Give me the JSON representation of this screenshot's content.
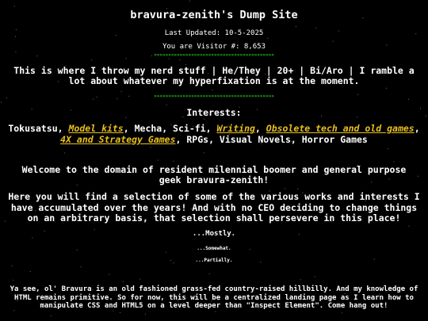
{
  "page": {
    "title": "bravura-zenith's Dump Site",
    "last_updated": "Last Updated: 10-5-2025",
    "visitor_counter": "You are Visitor #: 8,653",
    "divider_pattern": "»»»»»»»»»»»»»»»»»»»»»»»»»»»»»»»»»»»»»»»»»»",
    "tagline": "This is where I throw my nerd stuff | He/They | 20+ | Bi/Aro | I ramble a lot about whatever my hyperfixation is at the moment.",
    "interests_heading": "Interests:",
    "interests": {
      "p1": "Tokusatsu, ",
      "link_model_kits": "Model kits",
      "p2": ", Mecha, Sci-fi, ",
      "link_writing": "Writing",
      "p3": ", ",
      "link_obsolete_tech": "Obsolete tech and old games",
      "p4": ", ",
      "link_4x": "4X and Strategy Games",
      "p5": ", RPGs, Visual Novels, Horror Games"
    },
    "welcome": "Welcome to the domain of resident milennial boomer and general purpose geek bravura-zenith!",
    "intro": "Here you will find a selection of some of the various works and interests I have accumulated over the years! And with no CEO deciding to change things on an arbitrary basis, that selection shall persevere in this place!",
    "mostly": "...Mostly.",
    "somewhat": "...Somewhat.",
    "partially": "...Partially.",
    "about": "Ya see, ol' Bravura is an old fashioned grass-fed country-raised hillbilly. And my knowledge of HTML remains primitive. So for now, this will be a centralized landing page as I learn how to manipulate CSS and HTML5 on a level deeper than \"Inspect Element\". Come hang out!"
  },
  "colors": {
    "background": "#000000",
    "text": "#ffffff",
    "link": "#e8c020",
    "divider": "#22cc22",
    "stars": "#6a6a6a"
  }
}
